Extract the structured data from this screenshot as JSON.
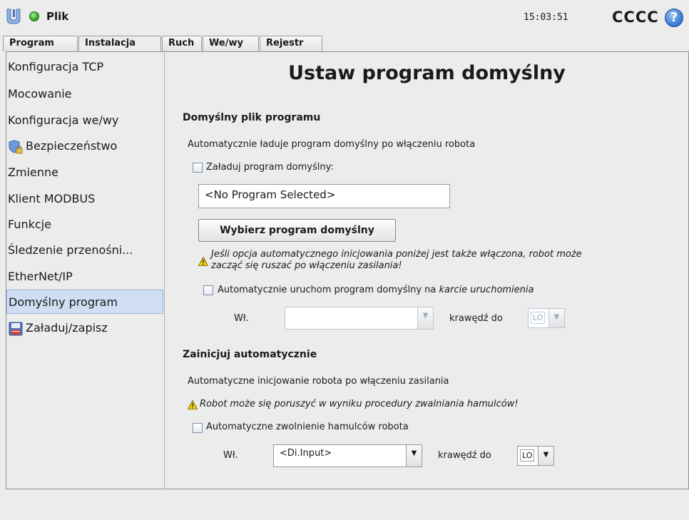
{
  "topbar": {
    "file_label": "Plik",
    "clock": "15:03:51",
    "robot_name": "CCCC",
    "help_label": "?"
  },
  "tabs": [
    {
      "label": "Program"
    },
    {
      "label": "Instalacja"
    },
    {
      "label": "Ruch"
    },
    {
      "label": "We/wy"
    },
    {
      "label": "Rejestr"
    }
  ],
  "sidebar": {
    "items": [
      {
        "label": "Konfiguracja TCP"
      },
      {
        "label": "Mocowanie"
      },
      {
        "label": "Konfiguracja we/wy"
      },
      {
        "label": "Bezpieczeństwo",
        "icon": "shield-lock-icon"
      },
      {
        "label": "Zmienne"
      },
      {
        "label": "Klient MODBUS"
      },
      {
        "label": "Funkcje"
      },
      {
        "label": "Śledzenie przenośni..."
      },
      {
        "label": "EtherNet/IP"
      },
      {
        "label": "Domyślny program"
      },
      {
        "label": "Załaduj/zapisz",
        "icon": "floppy-disk-icon"
      }
    ]
  },
  "main": {
    "title": "Ustaw program domyślny",
    "default_file": {
      "heading": "Domyślny plik programu",
      "description": "Automatycznie ładuje program domyślny po włączeniu robota",
      "load_checkbox_label": "Załaduj program domyślny:",
      "program_field_value": "<No Program Selected>",
      "choose_button": "Wybierz program domyślny",
      "warning_line1": "Jeśli opcja automatycznego inicjowania poniżej jest także włączona, robot może",
      "warning_line2": "zacząć się ruszać po włączeniu zasilania!",
      "autostart_label_prefix": "Automatycznie uruchom program domyślny na ",
      "autostart_label_italic": "karcie uruchomienia",
      "on_label": "Wł.",
      "edge_label": "krawędź do",
      "edge_value": "LO"
    },
    "auto_init": {
      "heading": "Zainicjuj automatycznie",
      "description": "Automatyczne inicjowanie robota po włączeniu zasilania",
      "warning": "Robot może się poruszyć w wyniku procedury zwalniania hamulców!",
      "brake_checkbox_label": "Automatyczne zwolnienie hamulców robota",
      "on_label": "Wł.",
      "input_value": "<Di.Input>",
      "edge_label": "krawędź do",
      "edge_value": "LO"
    }
  },
  "colors": {
    "accent": "#cfdef2",
    "status_ok": "#3cb531",
    "help": "#3d7fd8"
  }
}
